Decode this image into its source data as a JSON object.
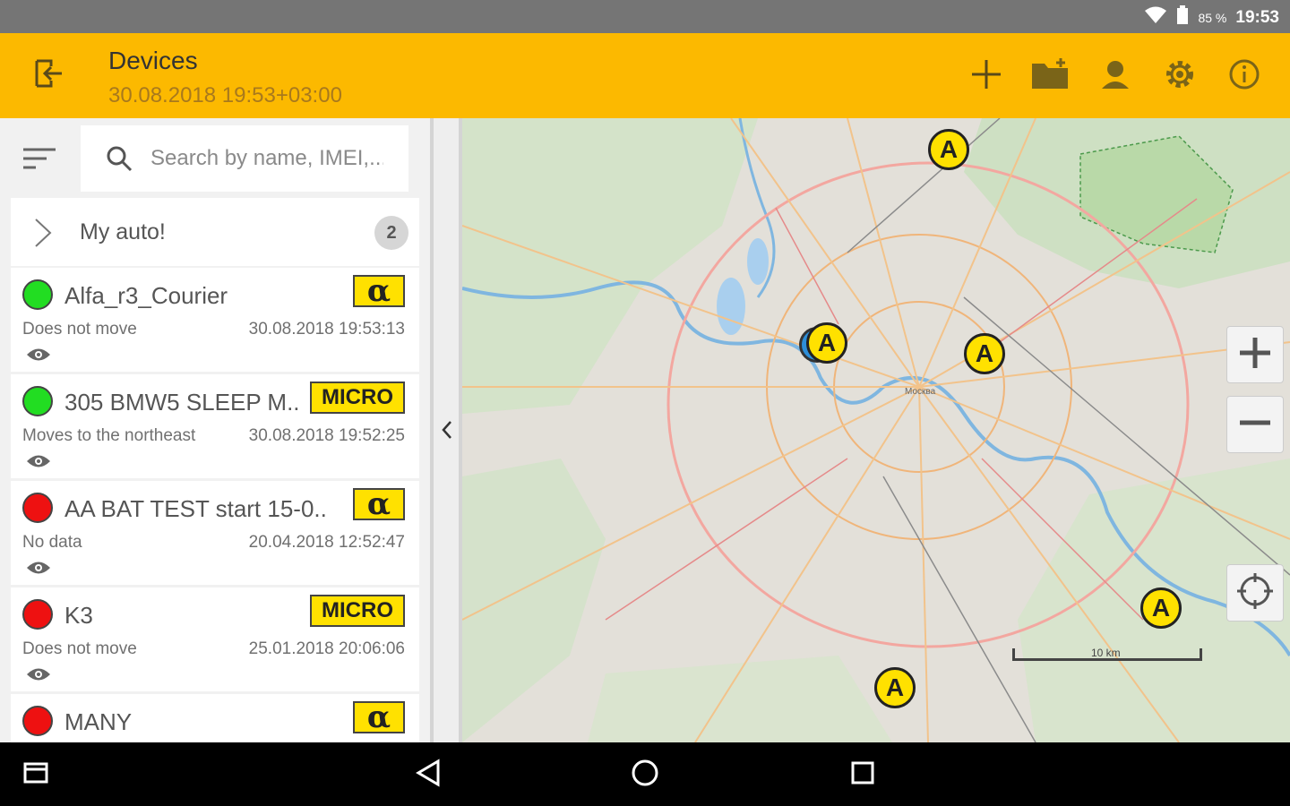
{
  "status_bar": {
    "battery": "85 %",
    "time": "19:53",
    "icons": [
      "wifi-icon",
      "battery-icon"
    ]
  },
  "app_bar": {
    "title": "Devices",
    "subtitle": "30.08.2018 19:53+03:00",
    "back_icon": "exit-icon",
    "actions": [
      "add-icon",
      "folder-add-icon",
      "user-icon",
      "gear-icon",
      "info-icon"
    ]
  },
  "search": {
    "placeholder": "Search by name, IMEI,..."
  },
  "group": {
    "name": "My auto!",
    "count": "2"
  },
  "devices": [
    {
      "name": "Alfa_r3_Courier",
      "status": "Does not move",
      "time": "30.08.2018 19:53:13",
      "badge": "α",
      "online": true
    },
    {
      "name": "305 BMW5 SLEEP M..",
      "status": "Moves to the northeast",
      "time": "30.08.2018 19:52:25",
      "badge": "MICRO",
      "online": true
    },
    {
      "name": "AA BAT TEST start 15-0..",
      "status": "No data",
      "time": "20.04.2018 12:52:47",
      "badge": "α",
      "online": false
    },
    {
      "name": "K3",
      "status": "Does not move",
      "time": "25.01.2018 20:06:06",
      "badge": "MICRO",
      "online": false
    },
    {
      "name": "MANY",
      "status": "",
      "time": "",
      "badge": "α",
      "online": false
    }
  ],
  "map": {
    "marker_letter": "A",
    "city_label": "Москва",
    "scale_label": "10 km",
    "zoom_in": "+",
    "zoom_out": "−"
  },
  "colors": {
    "accent": "#fcb900",
    "online": "#22dd22",
    "offline": "#ee1111",
    "badge": "#ffe100"
  }
}
